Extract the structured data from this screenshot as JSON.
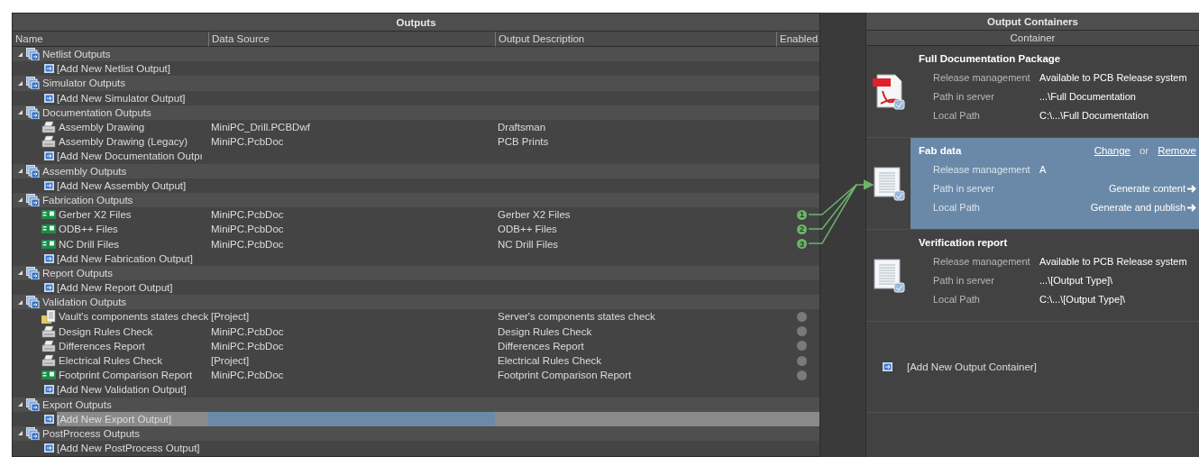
{
  "outputs": {
    "title": "Outputs",
    "columns": [
      "Name",
      "Data Source",
      "Output Description",
      "Enabled"
    ],
    "groups": [
      {
        "name": "Netlist Outputs",
        "expanded": true,
        "children": [
          {
            "kind": "add",
            "name": "[Add New Netlist Output]",
            "selected": false
          }
        ]
      },
      {
        "name": "Simulator Outputs",
        "expanded": true,
        "children": [
          {
            "kind": "add",
            "name": "[Add New Simulator Output]",
            "selected": false
          }
        ]
      },
      {
        "name": "Documentation Outputs",
        "expanded": true,
        "children": [
          {
            "kind": "printer",
            "name": "Assembly Drawing",
            "source": "MiniPC_Drill.PCBDwf",
            "description": "Draftsman",
            "selected": false
          },
          {
            "kind": "printer",
            "name": "Assembly Drawing (Legacy)",
            "source": "MiniPC.PcbDoc",
            "description": "PCB Prints",
            "selected": false
          },
          {
            "kind": "add",
            "name": "[Add New Documentation Outpı",
            "selected": false
          }
        ]
      },
      {
        "name": "Assembly Outputs",
        "expanded": true,
        "children": [
          {
            "kind": "add",
            "name": "[Add New Assembly Output]",
            "selected": false
          }
        ]
      },
      {
        "name": "Fabrication Outputs",
        "expanded": true,
        "children": [
          {
            "kind": "board",
            "name": "Gerber X2 Files",
            "source": "MiniPC.PcbDoc",
            "description": "Gerber X2 Files",
            "link_number": "1",
            "selected": false
          },
          {
            "kind": "board",
            "name": "ODB++ Files",
            "source": "MiniPC.PcbDoc",
            "description": "ODB++ Files",
            "link_number": "2",
            "selected": false
          },
          {
            "kind": "board",
            "name": "NC Drill Files",
            "source": "MiniPC.PcbDoc",
            "description": "NC Drill Files",
            "link_number": "3",
            "selected": false
          },
          {
            "kind": "add",
            "name": "[Add New Fabrication Output]",
            "selected": false
          }
        ]
      },
      {
        "name": "Report Outputs",
        "expanded": true,
        "children": [
          {
            "kind": "add",
            "name": "[Add New Report Output]",
            "selected": false
          }
        ]
      },
      {
        "name": "Validation Outputs",
        "expanded": true,
        "children": [
          {
            "kind": "checklist",
            "name": "Vault's components states check",
            "source": "[Project]",
            "description": "Server's components states check",
            "enabled": false,
            "selected": false
          },
          {
            "kind": "printer",
            "name": "Design Rules Check",
            "source": "MiniPC.PcbDoc",
            "description": "Design Rules Check",
            "enabled": false,
            "selected": false
          },
          {
            "kind": "printer",
            "name": "Differences Report",
            "source": "MiniPC.PcbDoc",
            "description": "Differences Report",
            "enabled": false,
            "selected": false
          },
          {
            "kind": "printer",
            "name": "Electrical Rules Check",
            "source": "[Project]",
            "description": "Electrical Rules Check",
            "enabled": false,
            "selected": false
          },
          {
            "kind": "board",
            "name": "Footprint Comparison Report",
            "source": "MiniPC.PcbDoc",
            "description": "Footprint Comparison Report",
            "enabled": false,
            "selected": false
          },
          {
            "kind": "add",
            "name": "[Add New Validation Output]",
            "selected": false
          }
        ]
      },
      {
        "name": "Export Outputs",
        "expanded": true,
        "children": [
          {
            "kind": "add",
            "name": "[Add New Export Output]",
            "selected": true
          }
        ]
      },
      {
        "name": "PostProcess Outputs",
        "expanded": true,
        "children": [
          {
            "kind": "add",
            "name": "[Add New PostProcess Output]",
            "selected": false
          }
        ]
      }
    ]
  },
  "containers": {
    "title": "Output Containers",
    "column": "Container",
    "items": [
      {
        "kind": "pdf",
        "name": "Full Documentation Package",
        "selected": false,
        "fields": [
          {
            "label": "Release management",
            "value": "Available to PCB Release system"
          },
          {
            "label": "Path in server",
            "value": "...\\Full Documentation"
          },
          {
            "label": "Local Path",
            "value": "C:\\...\\Full Documentation"
          }
        ]
      },
      {
        "kind": "document",
        "name": "Fab data",
        "selected": true,
        "links": [
          "Change",
          "Remove"
        ],
        "separator": "or",
        "fields": [
          {
            "label": "Release management",
            "value": "A"
          },
          {
            "label": "Path in server",
            "action": "Generate content"
          },
          {
            "label": "Local Path",
            "action": "Generate and publish"
          }
        ]
      },
      {
        "kind": "document",
        "name": "Verification report",
        "selected": false,
        "fields": [
          {
            "label": "Release management",
            "value": "Available to PCB Release system"
          },
          {
            "label": "Path in server",
            "value": "...\\[Output Type]\\"
          },
          {
            "label": "Local Path",
            "value": "C:\\...\\[Output Type]\\"
          }
        ]
      }
    ],
    "add_label": "[Add New Output Container]"
  }
}
